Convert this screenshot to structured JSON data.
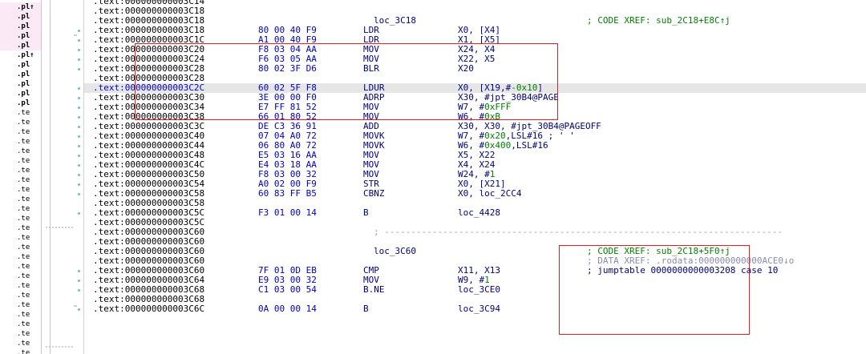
{
  "sidebar": {
    "items": [
      ".pl↑",
      ".pl",
      ".pl",
      ".pl",
      ".pl",
      ".pl↑",
      ".pl",
      ".pl",
      ".pl",
      ".pl",
      ".pl",
      ".te",
      ".te",
      ".te",
      ".te",
      ".te",
      ".te",
      ".te",
      ".te",
      ".te",
      ".te",
      ".te",
      ".te",
      ".te",
      ".te",
      ".te",
      ".te",
      ".te",
      ".te",
      ".te",
      ".te",
      ".te",
      ".te",
      ".te",
      ".te",
      ".te",
      ".te"
    ]
  },
  "listing": [
    {
      "addr": ".text:000000000003C14"
    },
    {
      "addr": ".text:000000000003C18"
    },
    {
      "addr": ".text:000000000003C18",
      "label": "loc_3C18",
      "comment": "; CODE XREF: sub_2C18+E8C↑j"
    },
    {
      "addr": ".text:000000000003C18",
      "bytes": "80 00 40 F9",
      "mnem": "LDR",
      "ops": "X0, [X4]"
    },
    {
      "addr": ".text:000000000003C1C",
      "bytes": "A1 00 40 F9",
      "mnem": "LDR",
      "ops": "X1, [X5]"
    },
    {
      "addr": ".text:000000000003C20",
      "bytes": "F8 03 04 AA",
      "mnem": "MOV",
      "ops": "X24, X4"
    },
    {
      "addr": ".text:000000000003C24",
      "bytes": "F6 03 05 AA",
      "mnem": "MOV",
      "ops": "X22, X5"
    },
    {
      "addr": ".text:000000000003C28",
      "bytes": "80 02 3F D6",
      "mnem": "BLR",
      "ops": "X20"
    },
    {
      "addr": ".text:000000000003C28"
    },
    {
      "addr": ".text:000000000003C2C",
      "bytes": "60 02 5F F8",
      "mnem": "LDUR",
      "ops": "X0, [X19,#",
      "num": "-0x10",
      "ops_tail": "]"
    },
    {
      "addr": ".text:000000000003C30",
      "bytes": "3E 00 00 F0",
      "mnem": "ADRP",
      "ops": "X30, #jpt_30B4@PAGE"
    },
    {
      "addr": ".text:000000000003C34",
      "bytes": "E7 FF 81 52",
      "mnem": "MOV",
      "ops": "W7, #",
      "num": "0xFFF"
    },
    {
      "addr": ".text:000000000003C38",
      "bytes": "66 01 80 52",
      "mnem": "MOV",
      "ops": "W6, #",
      "num": "0xB"
    },
    {
      "addr": ".text:000000000003C3C",
      "bytes": "DE C3 36 91",
      "mnem": "ADD",
      "ops": "X30, X30, #jpt_30B4@PAGEOFF"
    },
    {
      "addr": ".text:000000000003C40",
      "bytes": "07 04 A0 72",
      "mnem": "MOVK",
      "ops": "W7, #",
      "num": "0x20",
      "ops_tail": ",LSL#16 ; ' '"
    },
    {
      "addr": ".text:000000000003C44",
      "bytes": "06 80 A0 72",
      "mnem": "MOVK",
      "ops": "W6, #",
      "num": "0x400",
      "ops_tail": ",LSL#16"
    },
    {
      "addr": ".text:000000000003C48",
      "bytes": "E5 03 16 AA",
      "mnem": "MOV",
      "ops": "X5, X22"
    },
    {
      "addr": ".text:000000000003C4C",
      "bytes": "E4 03 18 AA",
      "mnem": "MOV",
      "ops": "X4, X24"
    },
    {
      "addr": ".text:000000000003C50",
      "bytes": "F8 03 00 32",
      "mnem": "MOV",
      "ops": "W24, #",
      "num": "1"
    },
    {
      "addr": ".text:000000000003C54",
      "bytes": "A0 02 00 F9",
      "mnem": "STR",
      "ops": "X0, [X21]"
    },
    {
      "addr": ".text:000000000003C58",
      "bytes": "60 83 FF B5",
      "mnem": "CBNZ",
      "ops": "X0, loc_2CC4"
    },
    {
      "addr": ".text:000000000003C58"
    },
    {
      "addr": ".text:000000000003C5C",
      "bytes": "F3 01 00 14",
      "mnem": "B",
      "ops": "loc_4428"
    },
    {
      "addr": ".text:000000000003C5C"
    },
    {
      "addr": ".text:000000000003C60",
      "separator": "; ---------------------------------------------------------------------------"
    },
    {
      "addr": ".text:000000000003C60"
    },
    {
      "addr": ".text:000000000003C60",
      "label": "loc_3C60",
      "comment": "; CODE XREF: sub_2C18+5F0↑j"
    },
    {
      "addr": ".text:000000000003C60",
      "comment": "; DATA XREF: .rodata:000000000000ACE0↓o",
      "comment_style": "gray"
    },
    {
      "addr": ".text:000000000003C60",
      "bytes": "7F 01 0D EB",
      "mnem": "CMP",
      "ops": "X11, X13",
      "comment": "; jumptable 0000000000003208 case 10",
      "comment_style": "blue"
    },
    {
      "addr": ".text:000000000003C64",
      "bytes": "E9 03 00 32",
      "mnem": "MOV",
      "ops": "W9, #",
      "num": "1"
    },
    {
      "addr": ".text:000000000003C68",
      "bytes": "C1 03 00 54",
      "mnem": "B.NE",
      "ops": "loc_3CE0"
    },
    {
      "addr": ".text:000000000003C68"
    },
    {
      "addr": ".text:000000000003C6C",
      "bytes": "0A 00 00 14",
      "mnem": "B",
      "ops": "loc_3C94"
    }
  ],
  "highlight_row": 9,
  "colors": {
    "highlight": "#e6e6e6",
    "annotation_box": "#e02020",
    "comment": "#008000",
    "bytes": "#0000c8",
    "code": "#000080"
  }
}
